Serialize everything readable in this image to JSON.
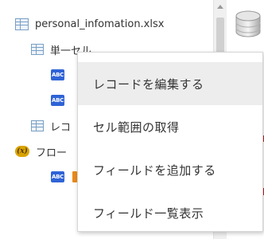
{
  "tree": {
    "items": [
      {
        "label": "personal_infomation.xlsx",
        "icon": "spreadsheet-icon"
      },
      {
        "label": "単一セル",
        "icon": "spreadsheet-icon"
      },
      {
        "label": "",
        "icon": "abc-text-icon"
      },
      {
        "label": "",
        "icon": "abc-text-icon"
      },
      {
        "label": "レコ",
        "icon": "spreadsheet-icon"
      },
      {
        "label": "フロー",
        "icon": "variable-icon"
      },
      {
        "label": "",
        "icon": "abc-text-icon"
      }
    ]
  },
  "icons": {
    "abc_text": "ABC",
    "variable": "(x)"
  },
  "context_menu": {
    "items": [
      {
        "label": "レコードを編集する",
        "highlighted": true
      },
      {
        "label": "セル範囲の取得",
        "highlighted": false
      },
      {
        "label": "フィールドを追加する",
        "highlighted": false
      },
      {
        "label": "フィールド一覧表示",
        "highlighted": false
      }
    ]
  },
  "colors": {
    "abc_badge": "#2f63d6",
    "variable_badge": "#d9a400",
    "menu_hover": "#ededed",
    "accent_orange": "#e98a1a",
    "accent_red": "#cc1f1f"
  }
}
